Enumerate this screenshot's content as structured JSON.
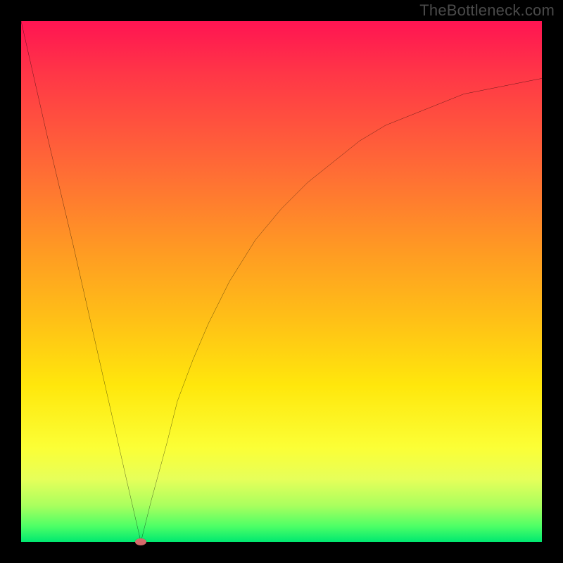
{
  "watermark": "TheBottleneck.com",
  "chart_data": {
    "type": "line",
    "title": "",
    "xlabel": "",
    "ylabel": "",
    "xlim": [
      0,
      100
    ],
    "ylim": [
      0,
      100
    ],
    "grid": false,
    "legend": false,
    "background": "red-to-green vertical gradient",
    "series": [
      {
        "name": "bottleneck-curve",
        "x": [
          0,
          5,
          10,
          15,
          20,
          23,
          25,
          28,
          30,
          33,
          36,
          40,
          45,
          50,
          55,
          60,
          65,
          70,
          75,
          80,
          85,
          90,
          95,
          100
        ],
        "values": [
          100,
          78,
          57,
          35,
          13,
          0,
          8,
          19,
          27,
          35,
          42,
          50,
          58,
          64,
          69,
          73,
          77,
          80,
          82,
          84,
          86,
          87,
          88,
          89
        ]
      }
    ],
    "marker": {
      "x": 23,
      "y": 0,
      "color": "#d46a6a"
    },
    "gradient_stops": [
      {
        "pct": 0,
        "color": "#ff1452"
      },
      {
        "pct": 10,
        "color": "#ff3647"
      },
      {
        "pct": 28,
        "color": "#ff6a36"
      },
      {
        "pct": 44,
        "color": "#ff9a23"
      },
      {
        "pct": 58,
        "color": "#ffc216"
      },
      {
        "pct": 70,
        "color": "#ffe70c"
      },
      {
        "pct": 82,
        "color": "#fbff36"
      },
      {
        "pct": 88,
        "color": "#e6ff5a"
      },
      {
        "pct": 93,
        "color": "#aaff5e"
      },
      {
        "pct": 97,
        "color": "#4dff66"
      },
      {
        "pct": 100,
        "color": "#00e870"
      }
    ]
  }
}
